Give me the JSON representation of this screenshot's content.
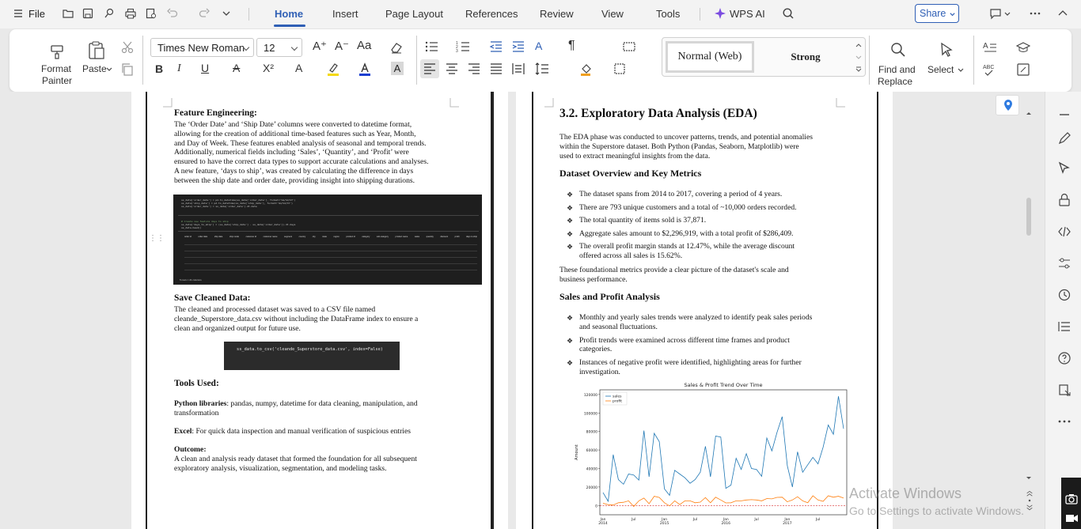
{
  "menubar": {
    "file_label": "File",
    "tabs": [
      "Home",
      "Insert",
      "Page Layout",
      "References",
      "Review",
      "View",
      "Tools"
    ],
    "wps_ai": "WPS AI",
    "share": "Share"
  },
  "ribbon": {
    "format_painter_1": "Format",
    "format_painter_2": "Painter",
    "paste": "Paste",
    "font_name": "Times New Roman",
    "font_size": "12",
    "style_1": "Normal (Web)",
    "style_2": "Strong",
    "find_replace_1": "Find and",
    "find_replace_2": "Replace",
    "select": "Select"
  },
  "left_page": {
    "fe_heading": "Feature Engineering:",
    "fe_lines": [
      "The ‘Order Date’ and ‘Ship Date’ columns were converted to datetime format,",
      "allowing for the creation of additional time-based features such as Year, Month,",
      "and Day of Week. These features enabled analysis of seasonal and temporal trends.",
      "Additionally, numerical fields including ‘Sales’, ‘Quantity’, and ‘Profit’ were",
      "ensured to have the correct data types to support accurate calculations and analyses.",
      "A new feature, ‘days to ship’, was created by calculating the difference in days",
      "between the ship date and order date, providing insight into shipping durations."
    ],
    "save_heading": "Save Cleaned Data:",
    "save_lines": [
      "The cleaned and processed dataset was saved to a CSV file named",
      "cleande_Superstore_data.csv without including the DataFrame index to ensure a",
      "clean and organized output for future use."
    ],
    "code_line": "ss_data.to_csv('cleande_Superstore_data.csv', index=False)",
    "tools_heading": "Tools Used:",
    "python_label": "Python libraries",
    "python_text_1": ": pandas, numpy, datetime for data cleaning, manipulation, and",
    "python_text_2": "transformation",
    "excel_label": "Excel",
    "excel_text": ": For quick data inspection and manual verification of suspicious entries",
    "outcome_label": "Outcome",
    "outcome_lines": [
      "A clean and analysis ready dataset that formed the foundation for all subsequent",
      "exploratory analysis, visualization, segmentation, and modeling tasks."
    ]
  },
  "right_page": {
    "title": "3.2. Exploratory Data Analysis (EDA)",
    "intro_lines": [
      "The EDA phase was conducted to uncover patterns, trends, and potential anomalies",
      "within the Superstore dataset. Both Python (Pandas, Seaborn, Matplotlib) were",
      "used to extract meaningful insights from the data."
    ],
    "overview_heading": "Dataset Overview and Key Metrics",
    "overview_bullets": [
      [
        "The dataset spans from 2014 to 2017, covering a period of 4 years."
      ],
      [
        "There are 793 unique customers and a total of ~10,000 orders recorded."
      ],
      [
        "The total quantity of items sold is 37,871."
      ],
      [
        "Aggregate sales amount to $2,296,919, with a total profit of $286,409."
      ],
      [
        "The overall profit margin stands at 12.47%, while the average discount",
        "offered across all sales is 15.62%."
      ]
    ],
    "foundation_lines": [
      "These foundational metrics provide a clear picture of the dataset's scale and",
      "business performance."
    ],
    "sales_heading": "Sales and Profit Analysis",
    "sales_bullets": [
      [
        "Monthly and yearly sales trends were analyzed to identify peak sales periods",
        "and seasonal fluctuations."
      ],
      [
        "Profit trends were examined across different time frames and product",
        "categories."
      ],
      [
        "Instances of negative profit were identified, highlighting areas for further",
        "investigation."
      ]
    ]
  },
  "chart_data": {
    "type": "line",
    "title": "Sales & Profit Trend Over Time",
    "ylabel": "Amount",
    "xlabel": "Year-Month",
    "ylim": [
      -10000,
      125000
    ],
    "yticks": [
      "0",
      "20000",
      "40000",
      "60000",
      "80000",
      "100000",
      "120000"
    ],
    "xticks": [
      "Jan\n2014",
      "Jul",
      "Jan\n2015",
      "Jul",
      "Jan\n2016",
      "Jul",
      "Jan\n2017",
      "Jul"
    ],
    "legend": "upper-left",
    "series": [
      {
        "name": "sales",
        "color": "#1f77b4",
        "values": [
          14000,
          4500,
          55000,
          28000,
          23000,
          34000,
          33000,
          27500,
          81000,
          31000,
          78000,
          69000,
          18000,
          11000,
          38000,
          34000,
          30000,
          24000,
          28000,
          36000,
          64000,
          31000,
          75000,
          74000,
          18500,
          22000,
          51000,
          39000,
          56000,
          40000,
          39000,
          31500,
          73000,
          59000,
          79000,
          96000,
          43000,
          20000,
          58000,
          36000,
          44000,
          52000,
          45000,
          63000,
          87000,
          77000,
          118000,
          83000
        ]
      },
      {
        "name": "profit",
        "color": "#ff7f0e",
        "values": [
          2500,
          900,
          500,
          3000,
          3500,
          5000,
          -1000,
          5000,
          8000,
          2000,
          10000,
          8700,
          3000,
          -400,
          5000,
          1000,
          5000,
          5000,
          3000,
          3700,
          8500,
          3000,
          9000,
          6000,
          2800,
          3000,
          5000,
          5000,
          6000,
          6300,
          6000,
          5000,
          7500,
          7200,
          8800,
          9000,
          4000,
          6000,
          9500,
          5000,
          3000,
          10500,
          6000,
          4500,
          10500,
          9000,
          10000,
          8000
        ]
      }
    ]
  },
  "code_blocks": {
    "fe_lines": [
      "ss_data['order_date'] = pd.to_datetime(ss_data['order_date'], format='%m/%d/%Y')",
      "ss_data['ship_date'] = pd.to_datetime(ss_data['ship_date'], format='%m/%d/%Y')",
      "ss_data['order_date'] = ss_data['order_date'].dt.date"
    ],
    "days_lines": [
      "# Create new feature days to ship",
      "ss_data['days_to_ship'] = (ss_data['ship_date'] - ss_data['order_date']).dt.days",
      "ss_data.head()"
    ],
    "df_columns": [
      "order id",
      "order date",
      "ship date",
      "ship mode",
      "customer id",
      "customer name",
      "segment",
      "country",
      "city",
      "state",
      "region",
      "product id",
      "category",
      "sub-category",
      "product name",
      "sales",
      "quantity",
      "discount",
      "profit",
      "days to ship"
    ],
    "rows_caption": "5 rows × 21 columns"
  },
  "watermark": {
    "line1": "Activate Windows",
    "line2": "Go to Settings to activate Windows."
  }
}
